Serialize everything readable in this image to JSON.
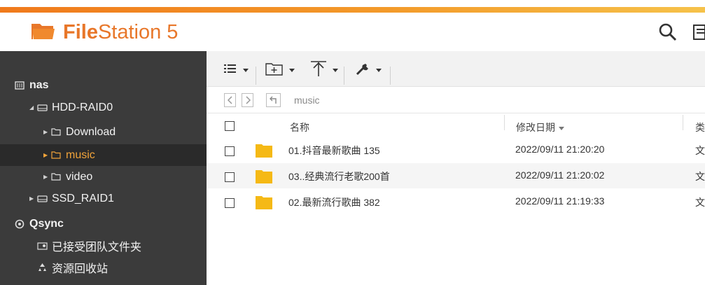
{
  "app": {
    "title_bold": "File",
    "title_regular": "Station 5",
    "accent_color": "#e8772a"
  },
  "header": {
    "icons": [
      "folder-icon",
      "search-icon",
      "task-list-icon"
    ]
  },
  "sidebar": {
    "items": [
      {
        "label": "nas",
        "icon": "nas-icon",
        "level": 0
      },
      {
        "label": "HDD-RAID0",
        "icon": "drive-icon",
        "level": 1,
        "expanded": true
      },
      {
        "label": "Download",
        "icon": "folder-outline-icon",
        "level": 2
      },
      {
        "label": "music",
        "icon": "folder-outline-icon",
        "level": 2,
        "selected": true
      },
      {
        "label": "video",
        "icon": "folder-outline-icon",
        "level": 2
      },
      {
        "label": "SSD_RAID1",
        "icon": "drive-icon",
        "level": 1
      },
      {
        "label": "Qsync",
        "icon": "qsync-icon",
        "level": 0
      },
      {
        "label": "已接受团队文件夹",
        "icon": "shared-folder-icon",
        "level": 1
      },
      {
        "label": "资源回收站",
        "icon": "recycle-icon",
        "level": 1
      }
    ]
  },
  "toolbar": {
    "buttons": [
      "list-view-icon",
      "new-folder-icon",
      "upload-icon",
      "tools-icon"
    ]
  },
  "path": {
    "current": "music"
  },
  "table": {
    "columns": [
      "名称",
      "修改日期",
      "类"
    ],
    "sort_column": "修改日期",
    "rows": [
      {
        "name": "01.抖音最新歌曲 135",
        "modified": "2022/09/11 21:20:20",
        "type": "文"
      },
      {
        "name": "03..经典流行老歌200首",
        "modified": "2022/09/11 21:20:02",
        "type": "文"
      },
      {
        "name": "02.最新流行歌曲 382",
        "modified": "2022/09/11 21:19:33",
        "type": "文"
      }
    ]
  },
  "colors": {
    "sidebar_bg": "#3b3b3b",
    "selected_text": "#f0a33a",
    "folder_yellow": "#f5b915"
  }
}
